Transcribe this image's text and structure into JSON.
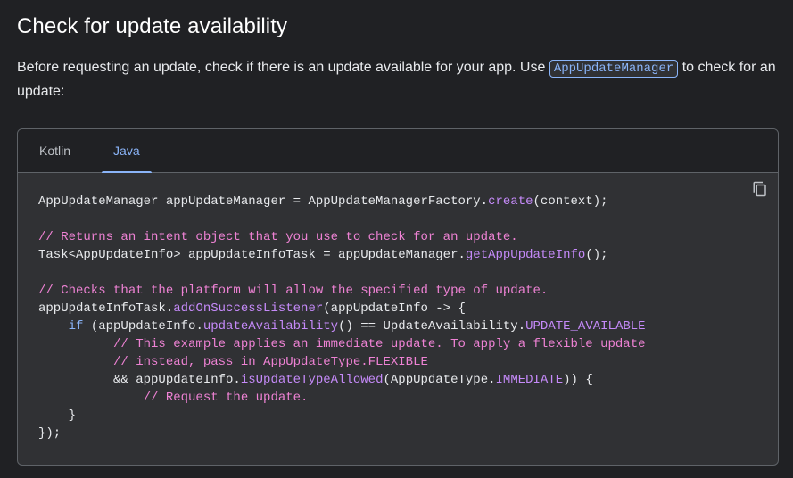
{
  "heading": "Check for update availability",
  "intro": {
    "before": "Before requesting an update, check if there is an update available for your app. Use ",
    "code": "AppUpdateManager",
    "after": " to check for an update:"
  },
  "tabs": [
    {
      "label": "Kotlin",
      "active": false
    },
    {
      "label": "Java",
      "active": true
    }
  ],
  "copy_icon": "copy-icon",
  "code_lines": [
    [
      {
        "t": "AppUpdateManager appUpdateManager = AppUpdateManagerFactory.",
        "s": ""
      },
      {
        "t": "create",
        "s": "m"
      },
      {
        "t": "(context);",
        "s": ""
      }
    ],
    [],
    [
      {
        "t": "// Returns an intent object that you use to check for an update.",
        "s": "c"
      }
    ],
    [
      {
        "t": "Task<AppUpdateInfo> appUpdateInfoTask = appUpdateManager.",
        "s": ""
      },
      {
        "t": "getAppUpdateInfo",
        "s": "m"
      },
      {
        "t": "();",
        "s": ""
      }
    ],
    [],
    [
      {
        "t": "// Checks that the platform will allow the specified type of update.",
        "s": "c"
      }
    ],
    [
      {
        "t": "appUpdateInfoTask.",
        "s": ""
      },
      {
        "t": "addOnSuccessListener",
        "s": "m"
      },
      {
        "t": "(appUpdateInfo -> {",
        "s": ""
      }
    ],
    [
      {
        "t": "    ",
        "s": ""
      },
      {
        "t": "if",
        "s": "k"
      },
      {
        "t": " (appUpdateInfo.",
        "s": ""
      },
      {
        "t": "updateAvailability",
        "s": "m"
      },
      {
        "t": "() == UpdateAvailability.",
        "s": ""
      },
      {
        "t": "UPDATE_AVAILABLE",
        "s": "m"
      }
    ],
    [
      {
        "t": "          // This example applies an immediate update. To apply a flexible update",
        "s": "c"
      }
    ],
    [
      {
        "t": "          // instead, pass in AppUpdateType.FLEXIBLE",
        "s": "c"
      }
    ],
    [
      {
        "t": "          && appUpdateInfo.",
        "s": ""
      },
      {
        "t": "isUpdateTypeAllowed",
        "s": "m"
      },
      {
        "t": "(AppUpdateType.",
        "s": ""
      },
      {
        "t": "IMMEDIATE",
        "s": "m"
      },
      {
        "t": ")) {",
        "s": ""
      }
    ],
    [
      {
        "t": "              // Request the update.",
        "s": "c"
      }
    ],
    [
      {
        "t": "    }",
        "s": ""
      }
    ],
    [
      {
        "t": "});",
        "s": ""
      }
    ]
  ]
}
